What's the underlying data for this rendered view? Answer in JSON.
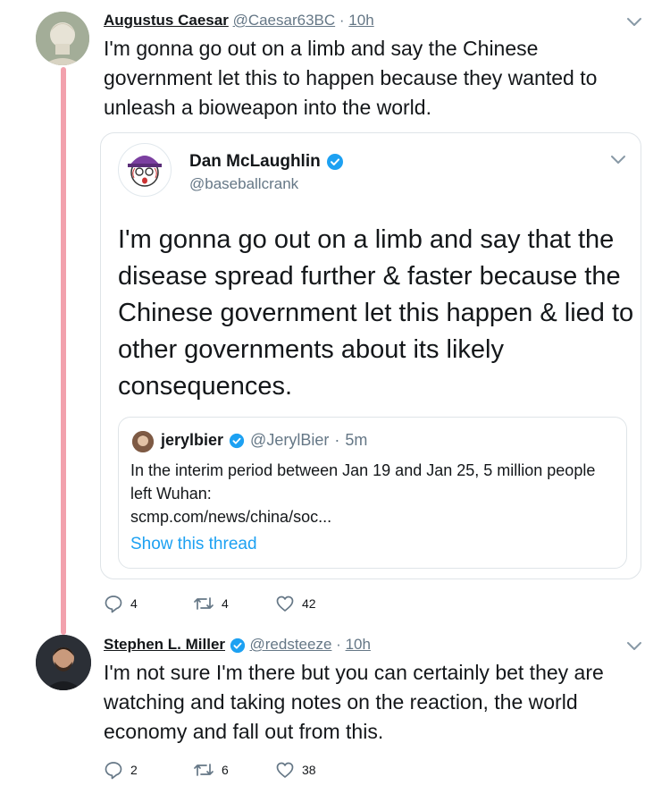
{
  "tweets": [
    {
      "name": "Augustus Caesar",
      "handle": "@Caesar63BC",
      "time": "10h",
      "text": "I'm gonna go out on a limb and say the Chinese government let this to happen because they wanted to unleash a bioweapon into the world.",
      "replies": "4",
      "retweets": "4",
      "likes": "42",
      "quoted": {
        "name": "Dan McLaughlin",
        "handle": "@baseballcrank",
        "text": "I'm gonna go out on a limb and say that the disease spread further & faster because the Chinese government let this happen & lied to other governments about its likely consequences.",
        "inner_quote": {
          "name": "jerylbier",
          "handle": "@JerylBier",
          "time": "5m",
          "text": "In the interim period between Jan 19 and Jan 25, 5 million people left Wuhan:",
          "link": "scmp.com/news/china/soc...",
          "show_thread": "Show this thread"
        }
      }
    },
    {
      "name": "Stephen L. Miller",
      "handle": "@redsteeze",
      "time": "10h",
      "text": "I'm not sure I'm there but you can certainly bet they are watching and taking notes on the reaction, the world economy and fall out from this.",
      "replies": "2",
      "retweets": "6",
      "likes": "38"
    }
  ],
  "separator": "·",
  "colors": {
    "thread_line": "#f2a1ad",
    "link": "#1da1f2",
    "verified": "#1da1f2",
    "meta": "#657786"
  },
  "icons": [
    "reply-icon",
    "retweet-icon",
    "like-icon",
    "chevron-down-icon",
    "verified-badge-icon"
  ]
}
